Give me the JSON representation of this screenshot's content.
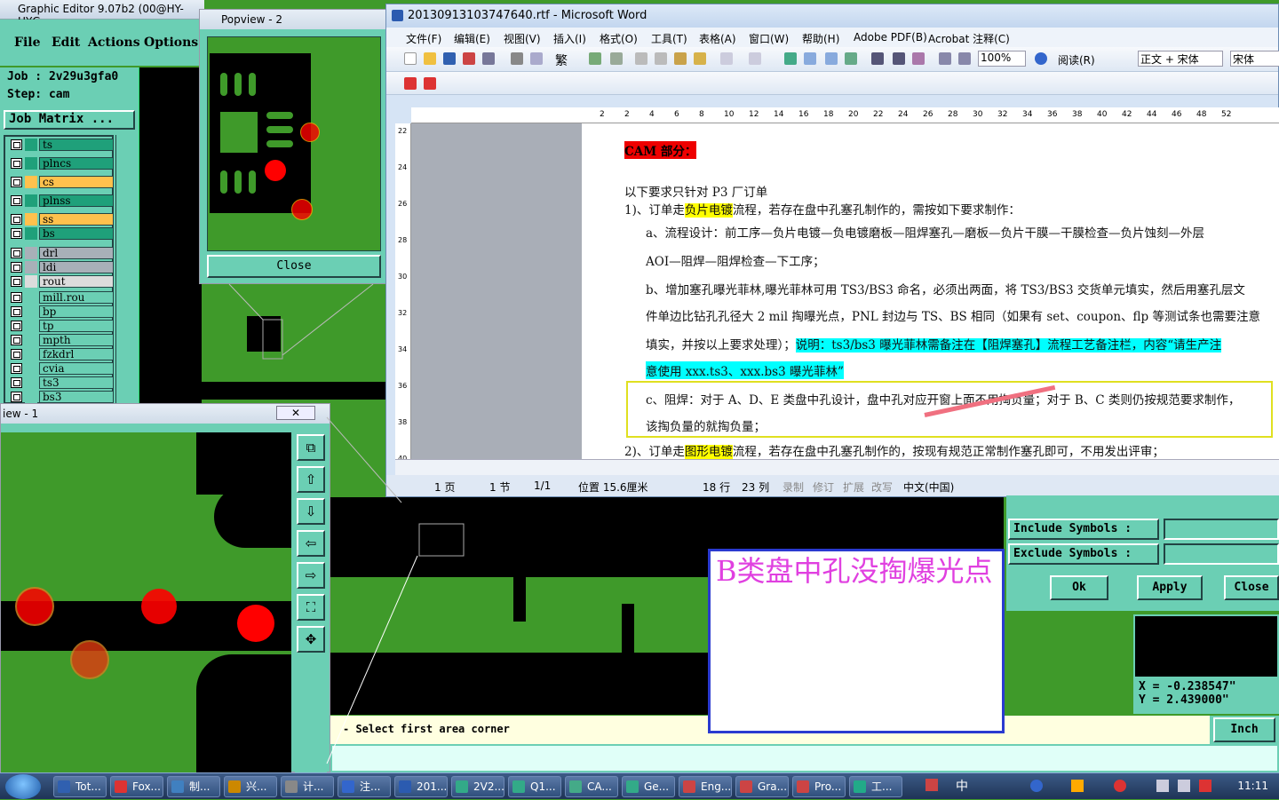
{
  "graphic_editor": {
    "title": "Graphic Editor 9.07b2 (00@HY-HYG",
    "menu": [
      "File",
      "Edit",
      "Actions",
      "Options"
    ],
    "job": "Job : 2v29u3gfa0",
    "step": "Step: cam",
    "job_matrix": "Job Matrix ...",
    "layers": [
      {
        "name": "ts",
        "color": "#1fa07a"
      },
      {
        "name": "plncs",
        "color": "#1fa07a"
      },
      {
        "name": "cs",
        "color": "#ffc14d"
      },
      {
        "name": "plnss",
        "color": "#1fa07a"
      },
      {
        "name": "ss",
        "color": "#ffc14d"
      },
      {
        "name": "bs",
        "color": "#1fa07a"
      },
      {
        "name": "drl",
        "color": "#a8b0b8"
      },
      {
        "name": "ldi",
        "color": "#a8b0b8"
      },
      {
        "name": "rout",
        "color": "#dcdcdc"
      },
      {
        "name": "mill.rou",
        "color": "#6bcfb4"
      },
      {
        "name": "bp",
        "color": "#6bcfb4"
      },
      {
        "name": "tp",
        "color": "#6bcfb4"
      },
      {
        "name": "mpth",
        "color": "#6bcfb4"
      },
      {
        "name": "fzkdrl",
        "color": "#6bcfb4"
      },
      {
        "name": "cvia",
        "color": "#6bcfb4"
      },
      {
        "name": "ts3",
        "color": "#6bcfb4"
      },
      {
        "name": "bs3",
        "color": "#6bcfb4"
      }
    ]
  },
  "popview": {
    "title": "Popview - 2",
    "close_label": "Close"
  },
  "view1": {
    "title": "iew - 1",
    "close_label": "✕"
  },
  "word": {
    "title": "20130913103747640.rtf - Microsoft Word",
    "menu": [
      "文件(F)",
      "编辑(E)",
      "视图(V)",
      "插入(I)",
      "格式(O)",
      "工具(T)",
      "表格(A)",
      "窗口(W)",
      "帮助(H)",
      "Adobe PDF(B)",
      "Acrobat 注释(C)"
    ],
    "zoom": "100%",
    "read_label": "阅读(R)",
    "style": "正文 + 宋体",
    "font": "宋体",
    "ruler": [
      "2",
      "2",
      "4",
      "6",
      "8",
      "10",
      "12",
      "14",
      "16",
      "18",
      "20",
      "22",
      "24",
      "26",
      "28",
      "30",
      "32",
      "34",
      "36",
      "38",
      "40",
      "42",
      "44",
      "46",
      "48",
      "52"
    ],
    "vruler": [
      "22",
      "24",
      "26",
      "28",
      "30",
      "32",
      "34",
      "36",
      "38",
      "40"
    ],
    "doc": {
      "heading": "CAM 部分：",
      "l1": "以下要求只针对 P3 厂订单",
      "l2a": "1)、订单走",
      "l2b": "负片电镀",
      "l2c": "流程，若存在盘中孔塞孔制作的，需按如下要求制作：",
      "l3": "a、流程设计：前工序—负片电镀—负电镀磨板—阻焊塞孔—磨板—负片干膜—干膜检查—负片蚀刻—外层",
      "l4": "AOI—阻焊—阻焊检查—下工序；",
      "l5": "b、增加塞孔曝光菲林,曝光菲林可用 TS3/BS3 命名，必须出两面，将 TS3/BS3 交货单元填实，然后用塞孔层文",
      "l6": "件单边比钻孔孔径大 2 mil 掏曝光点，PNL 封边与 TS、BS 相同（如果有 set、coupon、flp 等测试条也需要注意",
      "l7a": "填实，并按以上要求处理）；",
      "l7b": "说明：ts3/bs3 曝光菲林需备注在【阻焊塞孔】流程工艺备注栏，内容“请生产注",
      "l8": "意使用 xxx.ts3、xxx.bs3 曝光菲林”",
      "l9": "c、阻焊：对于 A、D、E 类盘中孔设计，盘中孔对应开窗上面不用掏负量；对于 B、C 类则仍按规范要求制作，",
      "l10": "该掏负量的就掏负量；",
      "l11a": "2)、订单走",
      "l11b": "图形电镀",
      "l11c": "流程，若存在盘中孔塞孔制作的，按现有规范正常制作塞孔即可，不用发出评审；"
    },
    "status": [
      "1 页",
      "1 节",
      "1/1",
      "位置 15.6厘米",
      "18 行",
      "23 列",
      "录制",
      "修订",
      "扩展",
      "改写",
      "中文(中国)"
    ]
  },
  "filter": {
    "include_label": "Include Symbols :",
    "exclude_label": "Exclude Symbols :",
    "ok": "Ok",
    "apply": "Apply",
    "close": "Close"
  },
  "coords": {
    "x": "X = -0.238547\"",
    "y": "Y = 2.439000\""
  },
  "command": "- Select first area corner",
  "unit": "Inch",
  "note": "B类盘中孔没掏爆光点",
  "taskbar": {
    "items": [
      "Tot...",
      "Fox...",
      "制...",
      "兴...",
      "计...",
      "注...",
      "201...",
      "2V2...",
      "Q1...",
      "CA...",
      "Ge...",
      "Eng...",
      "Gra...",
      "Pro...",
      "工..."
    ],
    "tray_text": "中",
    "clock": "11:11"
  }
}
